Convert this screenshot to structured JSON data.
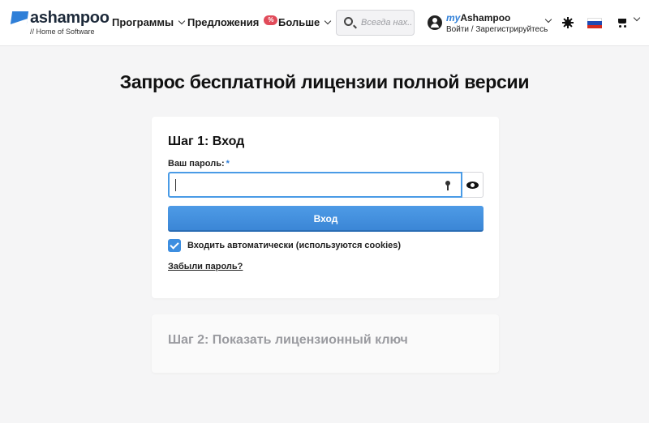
{
  "header": {
    "logo": {
      "name": "ashampoo",
      "tagline": "// Home of Software"
    },
    "nav": [
      {
        "label": "Программы"
      },
      {
        "label": "Предложения",
        "badge": "%"
      },
      {
        "label": "Больше"
      }
    ],
    "search": {
      "placeholder": "Всегда нах..."
    },
    "account": {
      "brand_prefix": "my",
      "brand_name": "Ashampoo",
      "sub": "Войти / Зарегистрируйтесь"
    },
    "icons": [
      "account-icon",
      "sun-icon",
      "flag-ru-icon",
      "cart-icon"
    ],
    "flag_colors": [
      "#ffffff",
      "#1f4bb4",
      "#d52b1e"
    ]
  },
  "page": {
    "title": "Запрос бесплатной лицензии полной версии"
  },
  "step1": {
    "title": "Шаг 1: Вход",
    "password_label": "Ваш пароль:",
    "required_mark": "*",
    "password_value": "",
    "login_button": "Вход",
    "remember_label": "Входить автоматически (используются cookies)",
    "remember_checked": true,
    "forgot_link": "Забыли пароль?"
  },
  "step2": {
    "title": "Шаг 2: Показать лицензионный ключ"
  },
  "colors": {
    "accent": "#3d8ee0",
    "badge": "#e14b5a"
  }
}
